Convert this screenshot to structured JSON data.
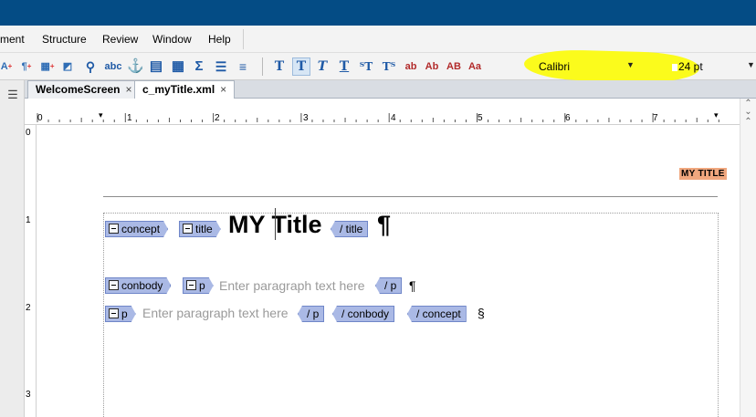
{
  "menubar": {
    "items": [
      "ment",
      "Structure",
      "Review",
      "Window",
      "Help"
    ]
  },
  "toolbar": {
    "insert_icons": [
      "xref-icon",
      "paragraph-insert-icon",
      "table-insert-icon",
      "image-insert-icon",
      "find-icon",
      "zoom-icon",
      "spellcheck-icon",
      "anchor-icon",
      "text-block-icon",
      "table-icon",
      "sigma-icon",
      "list-icon",
      "numbered-list-icon"
    ],
    "spellcheck_label": "abc",
    "sigma_label": "Σ",
    "style_buttons": [
      "T",
      "T",
      "T",
      "T",
      "ᵀT",
      "Tᵀ"
    ],
    "case_buttons": [
      "ab",
      "Ab",
      "AB",
      "Aa"
    ],
    "font_name": "Calibri",
    "font_size": "24 pt"
  },
  "left_panel": {
    "menu_glyph": "☰"
  },
  "tabs": [
    {
      "label": "WelcomeScreen",
      "close": "×"
    },
    {
      "label": "c_myTitle.xml",
      "close": "×"
    }
  ],
  "ruler": {
    "numbers": [
      "0",
      "1",
      "2",
      "3",
      "4",
      "5",
      "6",
      "7"
    ],
    "vertical_numbers": [
      "0",
      "1",
      "2",
      "3"
    ]
  },
  "document": {
    "header_text": "MY TITLE",
    "title_text": "MY Title",
    "pilcrow": "¶",
    "section_mark": "§",
    "placeholder": "Enter paragraph text here",
    "tags": {
      "concept": "concept",
      "title": "title",
      "conbody": "conbody",
      "p": "p",
      "close_title": "/  title",
      "close_p": "/  p",
      "close_conbody": "/  conbody",
      "close_concept": "/  concept"
    }
  },
  "colors": {
    "title_bar": "#044c85",
    "highlight": "#fbfb1c",
    "tag_fill": "#aab9e5",
    "header_bg": "#f0a77e"
  }
}
